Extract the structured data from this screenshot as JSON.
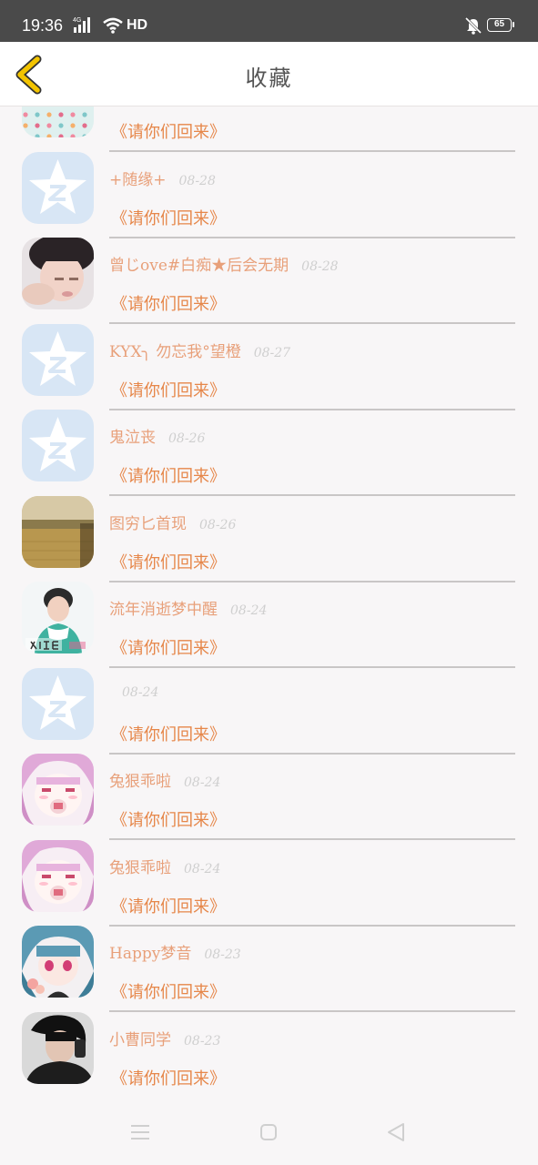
{
  "status_bar": {
    "time": "19:36",
    "signal_label": "4G",
    "hd_label": "HD",
    "battery": "65"
  },
  "header": {
    "title": "收藏"
  },
  "favorites": [
    {
      "name": "",
      "date": "",
      "message": "《请你们回来》",
      "avatar": "floral-pattern"
    },
    {
      "name": "+随缘+",
      "date": "08-28",
      "message": "《请你们回来》",
      "avatar": "qzone-default"
    },
    {
      "name": "曾じove#白痴★后会无期",
      "date": "08-28",
      "message": "《请你们回来》",
      "avatar": "photo-boy"
    },
    {
      "name": "KYX╮ 勿忘我°望橙",
      "date": "08-27",
      "message": "《请你们回来》",
      "avatar": "qzone-default"
    },
    {
      "name": "鬼泣丧",
      "date": "08-26",
      "message": "《请你们回来》",
      "avatar": "qzone-default"
    },
    {
      "name": "图穷匕首现",
      "date": "08-26",
      "message": "《请你们回来》",
      "avatar": "photo-field"
    },
    {
      "name": "流年消逝梦中醒",
      "date": "08-24",
      "message": "《请你们回来》",
      "avatar": "photo-person"
    },
    {
      "name": "",
      "date": "08-24",
      "message": "《请你们回来》",
      "avatar": "qzone-default"
    },
    {
      "name": "兔狠乖啦",
      "date": "08-24",
      "message": "《请你们回来》",
      "avatar": "anime-pink"
    },
    {
      "name": "兔狠乖啦",
      "date": "08-24",
      "message": "《请你们回来》",
      "avatar": "anime-pink"
    },
    {
      "name": "Happy梦音",
      "date": "08-23",
      "message": "《请你们回来》",
      "avatar": "anime-blue"
    },
    {
      "name": "小曹同学",
      "date": "08-23",
      "message": "《请你们回来》",
      "avatar": "photo-dark"
    }
  ],
  "colors": {
    "accent": "#e6874a",
    "name": "#e8a07a",
    "date": "#cfcfcf",
    "back_arrow": "#f3c400"
  }
}
